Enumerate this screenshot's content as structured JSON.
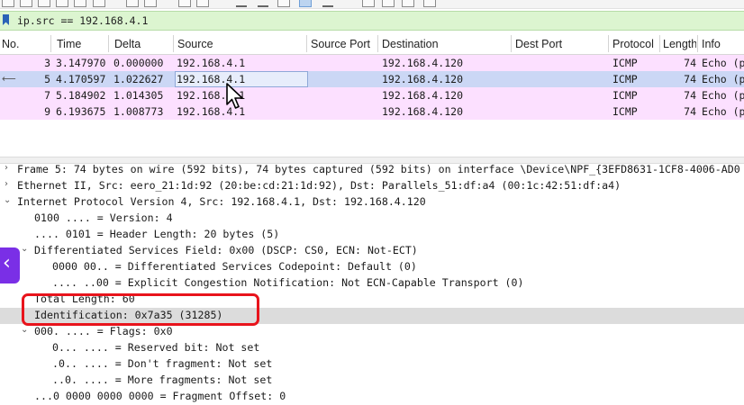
{
  "filter": {
    "value": "ip.src == 192.168.4.1"
  },
  "packet_list": {
    "columns": {
      "no": "No.",
      "time": "Time",
      "delta": "Delta",
      "source": "Source",
      "source_port": "Source Port",
      "destination": "Destination",
      "dest_port": "Dest Port",
      "protocol": "Protocol",
      "length": "Length",
      "info": "Info"
    },
    "rows": [
      {
        "no": "3",
        "time": "3.147970",
        "delta": "0.000000",
        "source": "192.168.4.1",
        "destination": "192.168.4.120",
        "protocol": "ICMP",
        "length": "74",
        "info": "Echo (p"
      },
      {
        "no": "5",
        "time": "4.170597",
        "delta": "1.022627",
        "source": "192.168.4.1",
        "destination": "192.168.4.120",
        "protocol": "ICMP",
        "length": "74",
        "info": "Echo (p"
      },
      {
        "no": "7",
        "time": "5.184902",
        "delta": "1.014305",
        "source": "192.168.4.1",
        "destination": "192.168.4.120",
        "protocol": "ICMP",
        "length": "74",
        "info": "Echo (p"
      },
      {
        "no": "9",
        "time": "6.193675",
        "delta": "1.008773",
        "source": "192.168.4.1",
        "destination": "192.168.4.120",
        "protocol": "ICMP",
        "length": "74",
        "info": "Echo (p"
      }
    ]
  },
  "details": [
    "Frame 5: 74 bytes on wire (592 bits), 74 bytes captured (592 bits) on interface \\Device\\NPF_{3EFD8631-1CF8-4006-AD0",
    "Ethernet II, Src: eero_21:1d:92 (20:be:cd:21:1d:92), Dst: Parallels_51:df:a4 (00:1c:42:51:df:a4)",
    "Internet Protocol Version 4, Src: 192.168.4.1, Dst: 192.168.4.120",
    "0100 .... = Version: 4",
    ".... 0101 = Header Length: 20 bytes (5)",
    "Differentiated Services Field: 0x00 (DSCP: CS0, ECN: Not-ECT)",
    "0000 00.. = Differentiated Services Codepoint: Default (0)",
    ".... ..00 = Explicit Congestion Notification: Not ECN-Capable Transport (0)",
    "Total Length: 60",
    "Identification: 0x7a35 (31285)",
    "000. .... = Flags: 0x0",
    "0... .... = Reserved bit: Not set",
    ".0.. .... = Don't fragment: Not set",
    "..0. .... = More fragments: Not set",
    "...0 0000 0000 0000 = Fragment Offset: 0"
  ],
  "side_tab": {
    "glyph": "‹"
  },
  "colors": {
    "icmp_row": "#fce0ff",
    "selected_row": "#cbd7f5",
    "filter_ok": "#dcf5d0",
    "annotation_red": "#e8141c",
    "side_tab": "#7a2fe6"
  }
}
